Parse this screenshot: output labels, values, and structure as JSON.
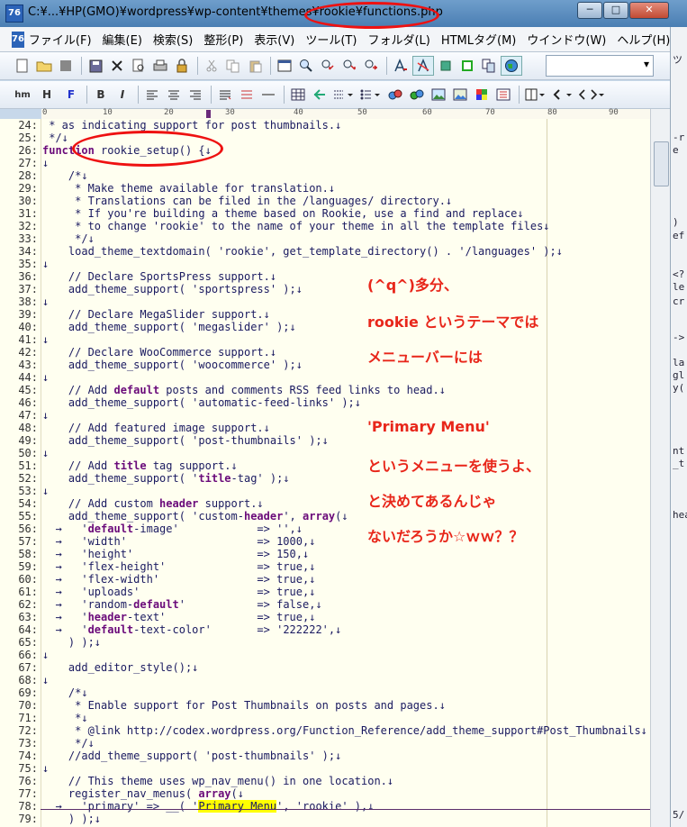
{
  "window": {
    "title": "C:¥...¥HP(GMO)¥wordpress¥wp-content¥themes¥rookie¥functions.php",
    "app_icon_text": "76",
    "buttons": [
      "─",
      "□",
      "✕"
    ]
  },
  "menu": [
    "ファイル(F)",
    "編集(E)",
    "検索(S)",
    "整形(P)",
    "表示(V)",
    "ツール(T)",
    "フォルダ(L)",
    "HTMLタグ(M)",
    "ウインドウ(W)",
    "ヘルプ(H)"
  ],
  "toolbar2": {
    "hm": "hm",
    "h": "H",
    "f": "F",
    "b": "B",
    "i": "I"
  },
  "ruler": [
    "0",
    "10",
    "20",
    "30",
    "40",
    "50",
    "60",
    "70",
    "80",
    "90"
  ],
  "code_lines": [
    {
      "n": "24",
      "t": " * as indicating support for post thumbnails.↓"
    },
    {
      "n": "25",
      "t": " */↓"
    },
    {
      "n": "26",
      "t": "function rookie_setup() {↓"
    },
    {
      "n": "27",
      "t": "↓"
    },
    {
      "n": "28",
      "t": "    /*↓"
    },
    {
      "n": "29",
      "t": "     * Make theme available for translation.↓"
    },
    {
      "n": "30",
      "t": "     * Translations can be filed in the /languages/ directory.↓"
    },
    {
      "n": "31",
      "t": "     * If you're building a theme based on Rookie, use a find and replace↓"
    },
    {
      "n": "32",
      "t": "     * to change 'rookie' to the name of your theme in all the template files↓"
    },
    {
      "n": "33",
      "t": "     */↓"
    },
    {
      "n": "34",
      "t": "    load_theme_textdomain( 'rookie', get_template_directory() . '/languages' );↓"
    },
    {
      "n": "35",
      "t": "↓"
    },
    {
      "n": "36",
      "t": "    // Declare SportsPress support.↓"
    },
    {
      "n": "37",
      "t": "    add_theme_support( 'sportspress' );↓"
    },
    {
      "n": "38",
      "t": "↓"
    },
    {
      "n": "39",
      "t": "    // Declare MegaSlider support.↓"
    },
    {
      "n": "40",
      "t": "    add_theme_support( 'megaslider' );↓"
    },
    {
      "n": "41",
      "t": "↓"
    },
    {
      "n": "42",
      "t": "    // Declare WooCommerce support.↓"
    },
    {
      "n": "43",
      "t": "    add_theme_support( 'woocommerce' );↓"
    },
    {
      "n": "44",
      "t": "↓"
    },
    {
      "n": "45",
      "t": "    // Add default posts and comments RSS feed links to head.↓"
    },
    {
      "n": "46",
      "t": "    add_theme_support( 'automatic-feed-links' );↓"
    },
    {
      "n": "47",
      "t": "↓"
    },
    {
      "n": "48",
      "t": "    // Add featured image support.↓"
    },
    {
      "n": "49",
      "t": "    add_theme_support( 'post-thumbnails' );↓"
    },
    {
      "n": "50",
      "t": "↓"
    },
    {
      "n": "51",
      "t": "    // Add title tag support.↓"
    },
    {
      "n": "52",
      "t": "    add_theme_support( 'title-tag' );↓"
    },
    {
      "n": "53",
      "t": "↓"
    },
    {
      "n": "54",
      "t": "    // Add custom header support.↓"
    },
    {
      "n": "55",
      "t": "    add_theme_support( 'custom-header', array(↓"
    },
    {
      "n": "56",
      "t": "  →   'default-image'            => '',↓"
    },
    {
      "n": "57",
      "t": "  →   'width'                    => 1000,↓"
    },
    {
      "n": "58",
      "t": "  →   'height'                   => 150,↓"
    },
    {
      "n": "59",
      "t": "  →   'flex-height'              => true,↓"
    },
    {
      "n": "60",
      "t": "  →   'flex-width'               => true,↓"
    },
    {
      "n": "61",
      "t": "  →   'uploads'                  => true,↓"
    },
    {
      "n": "62",
      "t": "  →   'random-default'           => false,↓"
    },
    {
      "n": "63",
      "t": "  →   'header-text'              => true,↓"
    },
    {
      "n": "64",
      "t": "  →   'default-text-color'       => '222222',↓"
    },
    {
      "n": "65",
      "t": "    ) );↓"
    },
    {
      "n": "66",
      "t": "↓"
    },
    {
      "n": "67",
      "t": "    add_editor_style();↓"
    },
    {
      "n": "68",
      "t": "↓"
    },
    {
      "n": "69",
      "t": "    /*↓"
    },
    {
      "n": "70",
      "t": "     * Enable support for Post Thumbnails on posts and pages.↓"
    },
    {
      "n": "71",
      "t": "     *↓"
    },
    {
      "n": "72",
      "t": "     * @link http://codex.wordpress.org/Function_Reference/add_theme_support#Post_Thumbnails↓"
    },
    {
      "n": "73",
      "t": "     */↓"
    },
    {
      "n": "74",
      "t": "    //add_theme_support( 'post-thumbnails' );↓"
    },
    {
      "n": "75",
      "t": "↓"
    },
    {
      "n": "76",
      "t": "    // This theme uses wp_nav_menu() in one location.↓"
    },
    {
      "n": "77",
      "t": "    register_nav_menus( array(↓"
    },
    {
      "n": "78",
      "t": "  →   'primary' => __( 'Primary Menu', 'rookie' ),↓"
    },
    {
      "n": "79",
      "t": "    ) );↓"
    }
  ],
  "annotation": [
    "(^q^)多分、",
    "rookie というテーマでは",
    "メニューバーには",
    "'Primary Menu'",
    "というメニューを使うよ、",
    "と決めてあるんじゃ",
    "ないだろうか☆ｗｗ？？"
  ],
  "right_pane_fragments": [
    "ツ",
    "-r",
    "e",
    ")",
    "ef",
    "<?",
    "le",
    "cr",
    "->",
    "la",
    "gl",
    "y(",
    "nt",
    "_t",
    "hea",
    "5/"
  ]
}
